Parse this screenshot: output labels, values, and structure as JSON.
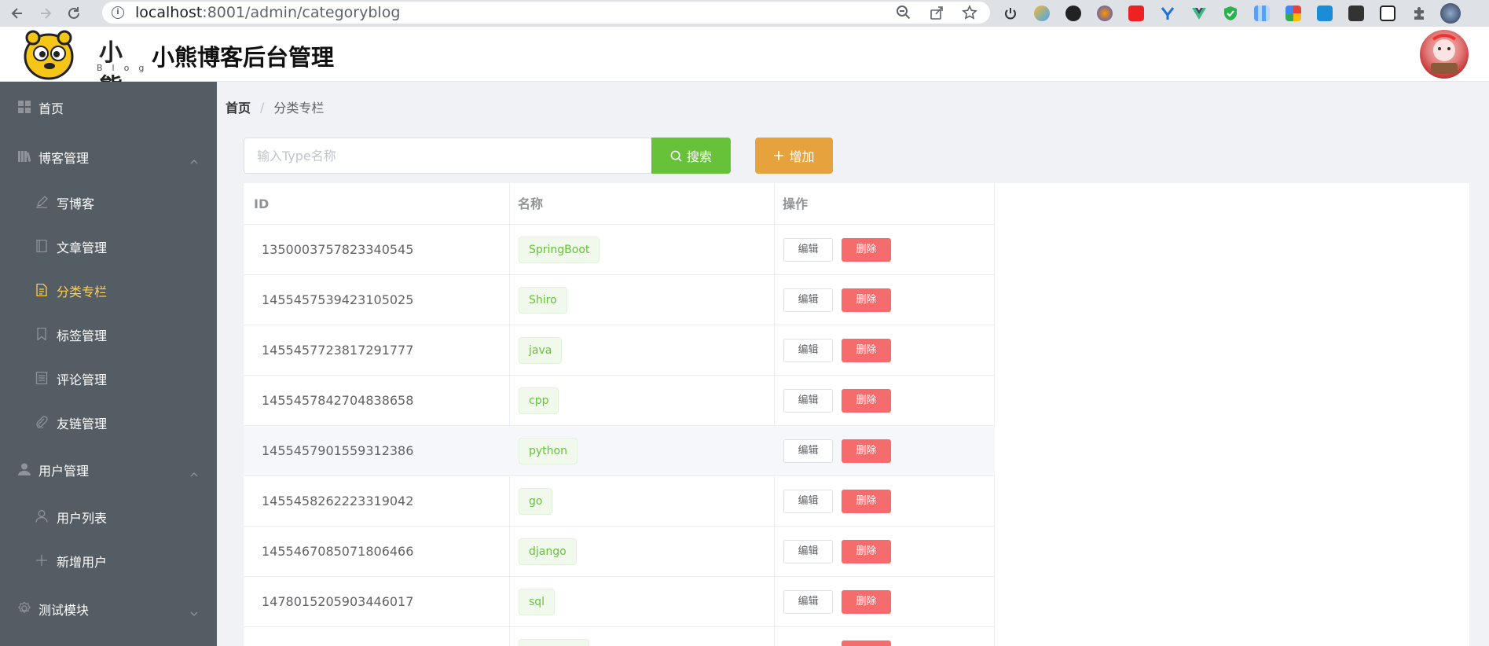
{
  "browser": {
    "url_host": "localhost",
    "url_path": ":8001/admin/categoryblog"
  },
  "header": {
    "logo_cn": "小熊",
    "logo_en": "Blog",
    "title": "小熊博客后台管理"
  },
  "sidebar": {
    "items": [
      {
        "label": "首页",
        "icon": "dashboard-icon"
      },
      {
        "label": "博客管理",
        "icon": "book-icon"
      },
      {
        "label": "写博客",
        "icon": "edit-icon"
      },
      {
        "label": "文章管理",
        "icon": "notebook-icon"
      },
      {
        "label": "分类专栏",
        "icon": "document-icon"
      },
      {
        "label": "标签管理",
        "icon": "bookmark-icon"
      },
      {
        "label": "评论管理",
        "icon": "list-icon"
      },
      {
        "label": "友链管理",
        "icon": "paperclip-icon"
      },
      {
        "label": "用户管理",
        "icon": "user-icon"
      },
      {
        "label": "用户列表",
        "icon": "user-outline-icon"
      },
      {
        "label": "新增用户",
        "icon": "plus-icon"
      },
      {
        "label": "测试模块",
        "icon": "settings-icon"
      }
    ],
    "active_color": "#ffd04b"
  },
  "breadcrumb": {
    "home": "首页",
    "current": "分类专栏"
  },
  "toolbar": {
    "search_placeholder": "输入Type名称",
    "search_label": "搜索",
    "add_label": "增加"
  },
  "table": {
    "headers": [
      "ID",
      "名称",
      "操作"
    ],
    "edit_label": "编辑",
    "delete_label": "删除",
    "rows": [
      {
        "id": "1350003757823340545",
        "name": "SpringBoot"
      },
      {
        "id": "1455457539423105025",
        "name": "Shiro"
      },
      {
        "id": "1455457723817291777",
        "name": "java"
      },
      {
        "id": "1455457842704838658",
        "name": "cpp"
      },
      {
        "id": "1455457901559312386",
        "name": "python"
      },
      {
        "id": "1455458262223319042",
        "name": "go"
      },
      {
        "id": "1455467085071806466",
        "name": "django"
      },
      {
        "id": "1478015205903446017",
        "name": "sql"
      }
    ]
  },
  "colors": {
    "sidebar_bg": "#545c64",
    "success": "#67c23a",
    "warning": "#e6a23c",
    "danger": "#f56c6c"
  }
}
